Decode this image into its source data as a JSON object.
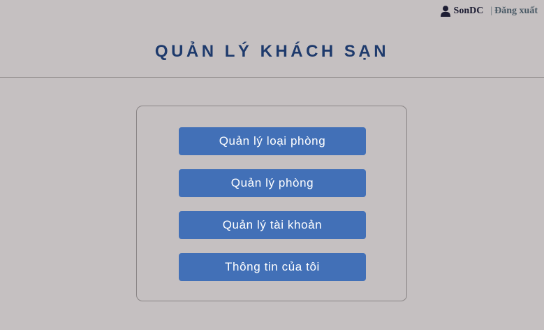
{
  "header": {
    "username": "SonDC",
    "separator": "|",
    "logout_label": "Đăng xuất",
    "user_icon": "user-icon"
  },
  "page": {
    "title": "QUẢN LÝ KHÁCH SẠN"
  },
  "menu": {
    "items": [
      {
        "label": "Quản lý loại phòng"
      },
      {
        "label": "Quản lý phòng"
      },
      {
        "label": "Quản lý tài khoản"
      },
      {
        "label": "Thông tin của tôi"
      }
    ]
  },
  "colors": {
    "background": "#c5c0c1",
    "title": "#1e3a6c",
    "button": "#4270b7",
    "button_text": "#ffffff"
  }
}
